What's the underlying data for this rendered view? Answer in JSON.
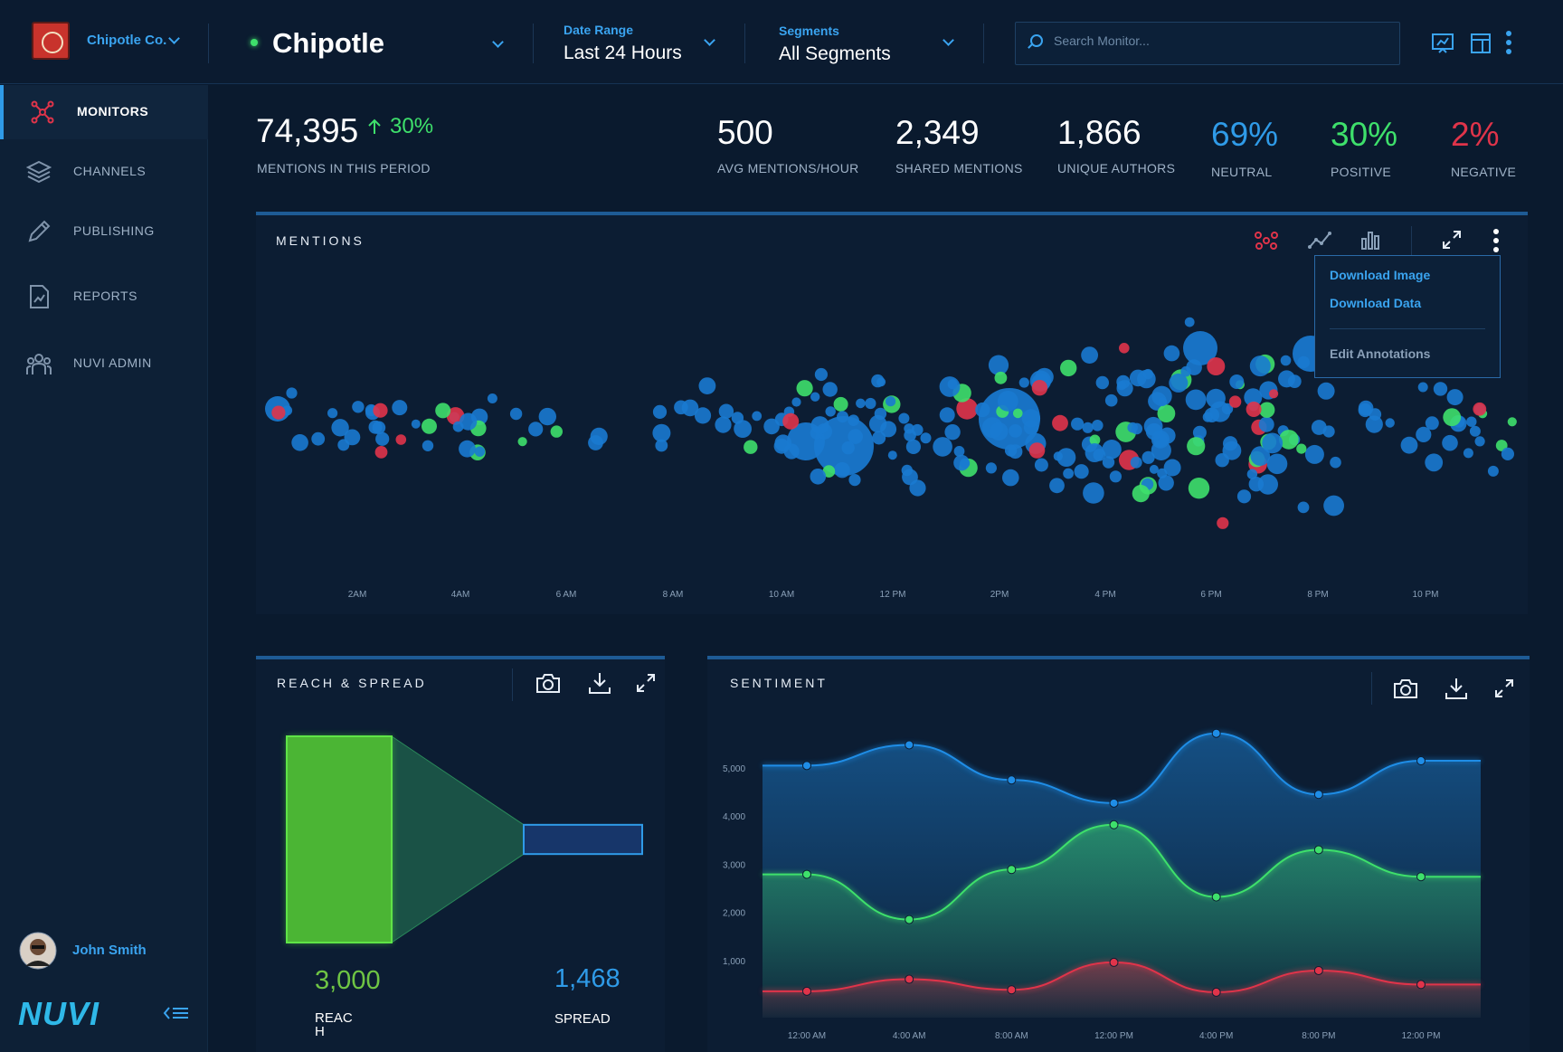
{
  "header": {
    "org_name": "Chipotle Co.",
    "monitor_name": "Chipotle",
    "date_range": {
      "label": "Date Range",
      "value": "Last 24 Hours"
    },
    "segments": {
      "label": "Segments",
      "value": "All Segments"
    },
    "search_placeholder": "Search Monitor..."
  },
  "sidebar": {
    "items": [
      {
        "label": "MONITORS",
        "icon": "monitors-icon",
        "active": true
      },
      {
        "label": "CHANNELS",
        "icon": "layers-icon"
      },
      {
        "label": "PUBLISHING",
        "icon": "pencil-icon"
      },
      {
        "label": "REPORTS",
        "icon": "report-icon"
      },
      {
        "label": "NUVI ADMIN",
        "icon": "users-icon"
      }
    ],
    "user_name": "John Smith",
    "brand": "NUVI"
  },
  "kpis": {
    "mentions": {
      "value": "74,395",
      "change": "30%",
      "label": "MENTIONS IN THIS PERIOD"
    },
    "avg": {
      "value": "500",
      "label": "AVG MENTIONS/HOUR"
    },
    "shared": {
      "value": "2,349",
      "label": "SHARED MENTIONS"
    },
    "authors": {
      "value": "1,866",
      "label": "UNIQUE AUTHORS"
    },
    "neutral": {
      "value": "69%",
      "label": "NEUTRAL"
    },
    "positive": {
      "value": "30%",
      "label": "POSITIVE"
    },
    "negative": {
      "value": "2%",
      "label": "NEGATIVE"
    }
  },
  "mentions_panel": {
    "title": "MENTIONS",
    "menu": [
      "Download Image",
      "Download Data",
      "Edit Annotations"
    ],
    "x_ticks": [
      "2AM",
      "4AM",
      "6 AM",
      "8 AM",
      "10 AM",
      "12 PM",
      "2PM",
      "4 PM",
      "6 PM",
      "8 PM",
      "10 PM"
    ]
  },
  "reach_panel": {
    "title": "REACH & SPREAD",
    "reach_value": "3,000",
    "reach_label": "REACH",
    "spread_value": "1,468",
    "spread_label": "SPREAD"
  },
  "sentiment_panel": {
    "title": "SENTIMENT"
  },
  "colors": {
    "accent": "#2f9be8",
    "neutral": "#1a7ad0",
    "positive": "#3ee06b",
    "negative": "#e0344a",
    "background": "#0a1a2e"
  },
  "chart_data": [
    {
      "type": "scatter",
      "title": "MENTIONS",
      "xlabel": "",
      "ylabel": "",
      "x_ticks": [
        "2AM",
        "4AM",
        "6 AM",
        "8 AM",
        "10 AM",
        "12 PM",
        "2PM",
        "4 PM",
        "6 PM",
        "8 PM",
        "10 PM"
      ],
      "series": [
        {
          "name": "Neutral",
          "color": "#1a7ad0"
        },
        {
          "name": "Positive",
          "color": "#3ee06b"
        },
        {
          "name": "Negative",
          "color": "#e0344a"
        }
      ],
      "note_density": [
        3,
        2,
        1,
        1,
        4,
        6,
        7,
        10,
        12,
        9,
        4
      ]
    },
    {
      "type": "area",
      "title": "SENTIMENT",
      "categories": [
        "12:00 AM",
        "4:00 AM",
        "8:00 AM",
        "12:00 PM",
        "4:00 PM",
        "8:00 PM",
        "12:00 PM"
      ],
      "y_ticks": [
        "1,000",
        "2,000",
        "3,000",
        "4,000",
        "5,000"
      ],
      "ylim": [
        0,
        5000
      ],
      "series": [
        {
          "name": "Neutral",
          "color": "#1f8de6",
          "values": [
            5050,
            5480,
            4750,
            4270,
            5720,
            4450,
            5150
          ]
        },
        {
          "name": "Positive",
          "color": "#3ee06b",
          "values": [
            2790,
            1850,
            2890,
            3820,
            2320,
            3300,
            2740
          ]
        },
        {
          "name": "Negative",
          "color": "#e0344a",
          "values": [
            360,
            610,
            390,
            960,
            340,
            790,
            500
          ]
        }
      ]
    },
    {
      "type": "bar",
      "title": "REACH & SPREAD",
      "categories": [
        "REACH",
        "SPREAD"
      ],
      "values": [
        3000,
        1468
      ]
    }
  ]
}
